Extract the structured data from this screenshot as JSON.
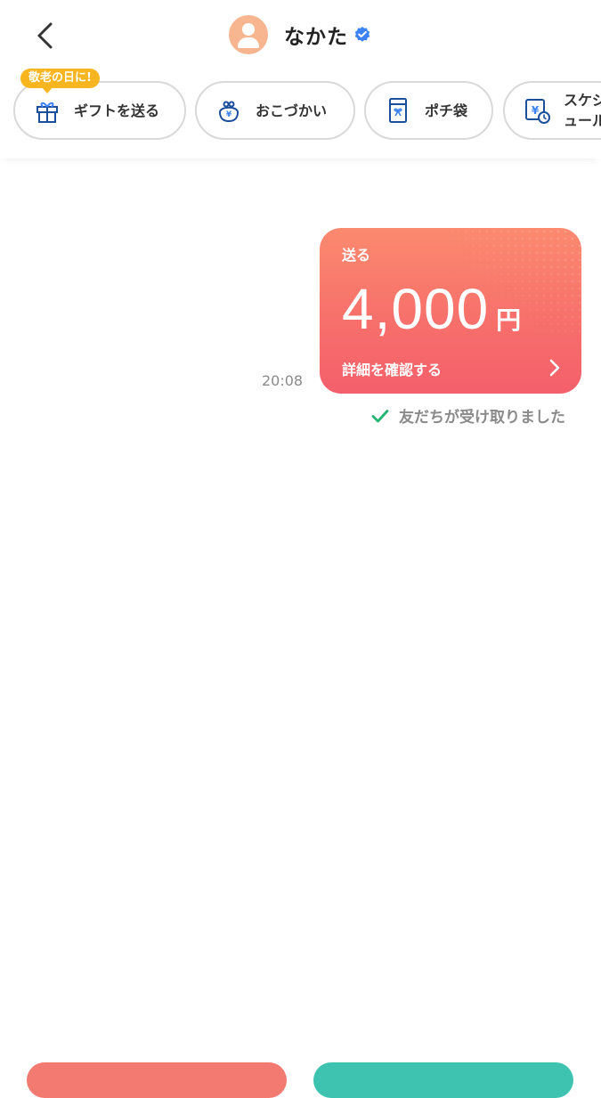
{
  "header": {
    "title": "なかた",
    "back_icon": "chevron-left-icon",
    "verified_icon": "verified-badge-icon"
  },
  "actions": {
    "badge": "敬老の日に!",
    "gift_label": "ギフトを送る",
    "allowance_label": "おこづかい",
    "envelope_label": "ポチ袋",
    "schedule_label": "スケジュール"
  },
  "message": {
    "time": "20:08",
    "card_label": "送る",
    "amount": "4,000",
    "currency": "円",
    "detail_label": "詳細を確認する",
    "status": "友だちが受け取りました"
  },
  "colors": {
    "card_gradient_top": "#fb8a6f",
    "card_gradient_bottom": "#f45f6b",
    "badge": "#f7b51f",
    "verified": "#3b82f6",
    "check": "#22b573",
    "avatar": "#f7b690"
  }
}
